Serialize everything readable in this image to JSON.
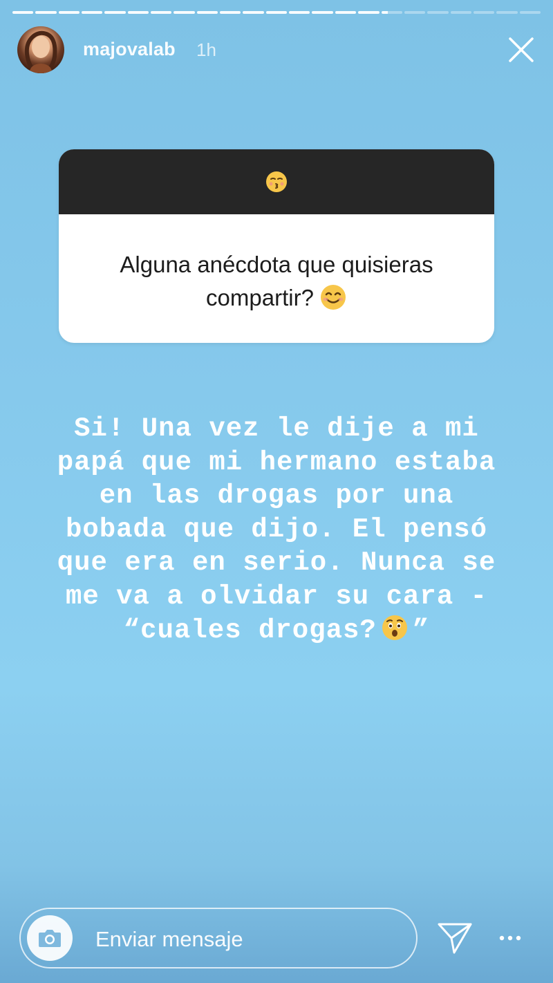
{
  "header": {
    "username": "majovalab",
    "time": "1h"
  },
  "progress": {
    "segments_total": 23,
    "segments_done": 16,
    "current_fraction": 0.3
  },
  "question_box": {
    "line1": "Alguna anécdota que quisieras",
    "line2": "compartir?",
    "top_icon": "kissing-face-emoji",
    "inline_icon": "smiling-face-emoji"
  },
  "story_text": {
    "lines": [
      "Si! Una vez le dije a mi",
      "papá que mi hermano estaba",
      "en las drogas por una",
      "bobada que dijo. El pensó",
      "que era en serio. Nunca se",
      "me va a olvidar su cara -",
      "“cuales drogas?",
      "”"
    ],
    "inline_icon": "astonished-face-emoji"
  },
  "reply": {
    "placeholder": "Enviar mensaje"
  },
  "colors": {
    "background": "#8cd0f1",
    "box_header": "#262626",
    "box_body": "#ffffff",
    "text_dark": "#1c1c1c",
    "text_light": "#ffffff"
  }
}
